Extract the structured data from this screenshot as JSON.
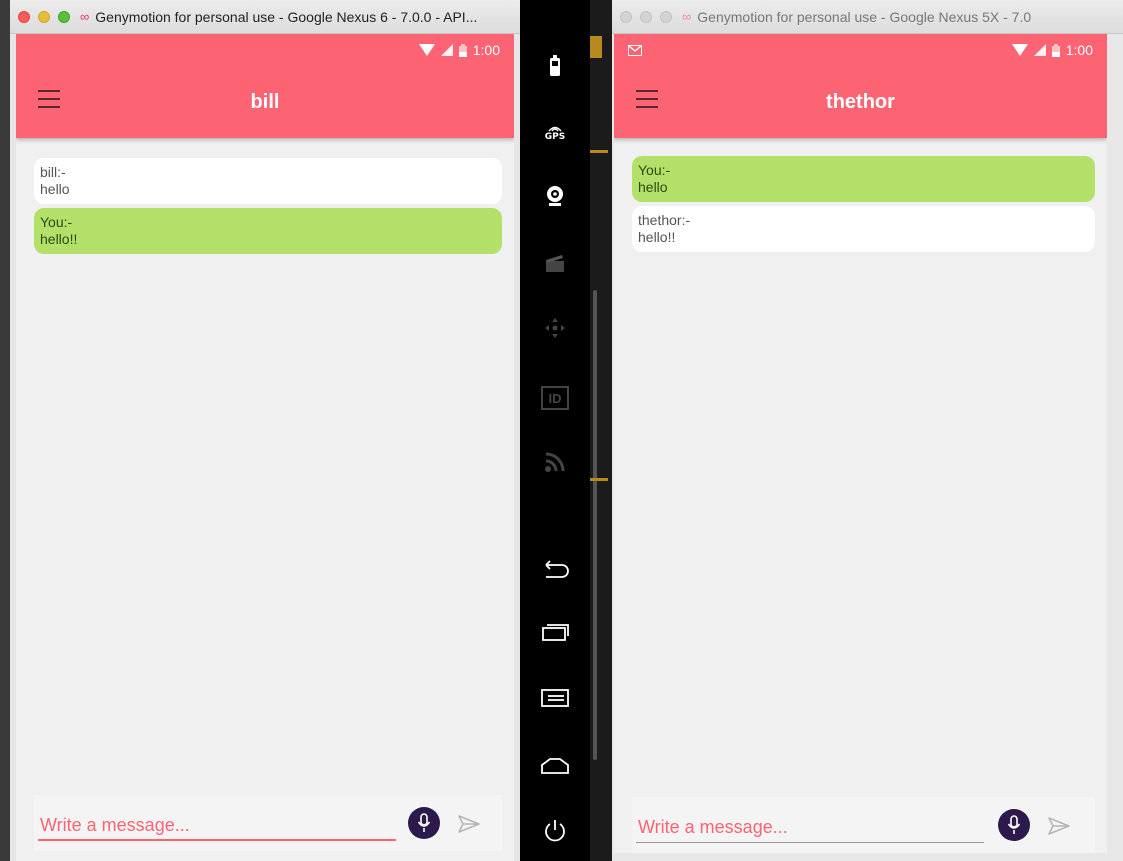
{
  "window_left": {
    "title": "Genymotion for personal use - Google Nexus 6 - 7.0.0 - API...",
    "status_time": "1:00",
    "app_title": "bill",
    "messages": [
      {
        "sender": "bill:-",
        "text": "hello",
        "own": false
      },
      {
        "sender": "You:-",
        "text": "hello!!",
        "own": true
      }
    ],
    "input_placeholder": "Write a message..."
  },
  "window_right": {
    "title": "Genymotion for personal use - Google Nexus 5X - 7.0",
    "status_time": "1:00",
    "app_title": "thethor",
    "messages": [
      {
        "sender": "You:-",
        "text": "hello",
        "own": true
      },
      {
        "sender": "thethor:-",
        "text": "hello!!",
        "own": false
      }
    ],
    "input_placeholder": "Write a message..."
  },
  "toolbar": {
    "items": [
      "battery-icon",
      "gps-icon",
      "webcam-icon",
      "capture-icon",
      "dpad-icon",
      "id-icon",
      "cast-icon",
      "back-icon",
      "recent-apps-icon",
      "menu-icon",
      "home-icon",
      "power-icon"
    ],
    "gps_label": "GPS",
    "id_label": "ID"
  },
  "colors": {
    "accent": "#fc6474",
    "own_bubble": "#b2e068",
    "other_bubble": "#ffffff",
    "mic_button": "#2b1a4b"
  }
}
